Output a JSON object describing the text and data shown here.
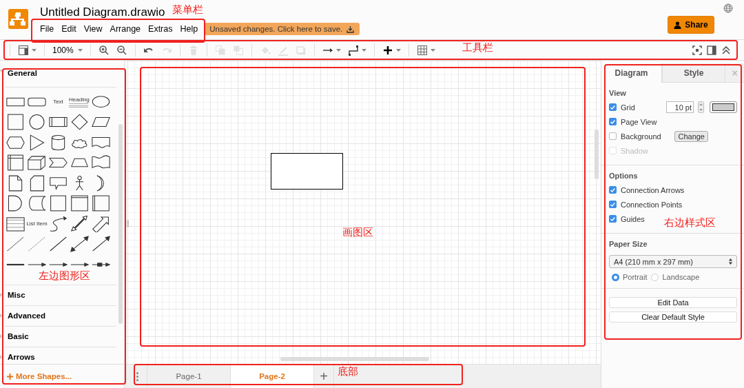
{
  "header": {
    "title": "Untitled Diagram.drawio",
    "menu": [
      "File",
      "Edit",
      "View",
      "Arrange",
      "Extras",
      "Help"
    ],
    "save_notice": "Unsaved changes. Click here to save.",
    "share": "Share"
  },
  "toolbar": {
    "groups": [
      [
        {
          "kind": "format",
          "disabled": false
        }
      ],
      [
        {
          "kind": "zoom",
          "text": "100%",
          "disabled": false
        }
      ],
      [
        {
          "kind": "zoom-in",
          "disabled": false
        },
        {
          "kind": "zoom-out",
          "disabled": false
        }
      ],
      [
        {
          "kind": "undo",
          "disabled": false
        },
        {
          "kind": "redo",
          "disabled": true
        }
      ],
      [
        {
          "kind": "delete",
          "disabled": true
        }
      ],
      [
        {
          "kind": "to-front",
          "disabled": true
        },
        {
          "kind": "to-back",
          "disabled": true
        }
      ],
      [
        {
          "kind": "fill",
          "disabled": true
        },
        {
          "kind": "line",
          "disabled": true
        },
        {
          "kind": "shadow",
          "disabled": true
        }
      ],
      [
        {
          "kind": "connection",
          "disabled": false
        },
        {
          "kind": "waypoints",
          "disabled": false
        }
      ],
      [
        {
          "kind": "insert",
          "disabled": false
        }
      ],
      [
        {
          "kind": "table",
          "disabled": false
        }
      ]
    ],
    "right": [
      {
        "kind": "fullscreen",
        "disabled": false
      },
      {
        "kind": "panel",
        "disabled": false
      },
      {
        "kind": "collapse",
        "disabled": false
      }
    ]
  },
  "sidebar": {
    "sections": [
      {
        "title": "General",
        "expanded": true,
        "shapes": [
          {
            "kind": "rect"
          },
          {
            "kind": "rounded"
          },
          {
            "kind": "text",
            "text": "Text"
          },
          {
            "kind": "heading",
            "text": "Heading"
          },
          {
            "kind": "ellipse"
          },
          {
            "kind": "square"
          },
          {
            "kind": "circle"
          },
          {
            "kind": "process"
          },
          {
            "kind": "diamond"
          },
          {
            "kind": "parallelogram"
          },
          {
            "kind": "hexagon"
          },
          {
            "kind": "triangle"
          },
          {
            "kind": "cylinder"
          },
          {
            "kind": "cloud"
          },
          {
            "kind": "document"
          },
          {
            "kind": "storage"
          },
          {
            "kind": "cube"
          },
          {
            "kind": "step"
          },
          {
            "kind": "trapezoid"
          },
          {
            "kind": "tape"
          },
          {
            "kind": "note"
          },
          {
            "kind": "card"
          },
          {
            "kind": "callout"
          },
          {
            "kind": "actor"
          },
          {
            "kind": "crescent"
          },
          {
            "kind": "delay"
          },
          {
            "kind": "stored"
          },
          {
            "kind": "square"
          },
          {
            "kind": "container"
          },
          {
            "kind": "vcontainer"
          },
          {
            "kind": "list"
          },
          {
            "kind": "listitem",
            "text": "List Item"
          },
          {
            "kind": "curve"
          },
          {
            "kind": "biarrow"
          },
          {
            "kind": "arrow"
          },
          {
            "kind": "dashed"
          },
          {
            "kind": "dotted"
          },
          {
            "kind": "line"
          },
          {
            "kind": "bidirectional"
          },
          {
            "kind": "directional"
          },
          {
            "kind": "thick"
          },
          {
            "kind": "connector"
          },
          {
            "kind": "connector"
          },
          {
            "kind": "connector"
          },
          {
            "kind": "boxconnector"
          }
        ]
      },
      {
        "title": "Misc",
        "expanded": false
      },
      {
        "title": "Advanced",
        "expanded": false
      },
      {
        "title": "Basic",
        "expanded": false
      },
      {
        "title": "Arrows",
        "expanded": false
      }
    ],
    "more": "More Shapes..."
  },
  "format_panel": {
    "tabs": [
      {
        "label": "Diagram",
        "selected": true
      },
      {
        "label": "Style",
        "selected": false
      }
    ],
    "close": "×",
    "sections": [
      {
        "title": "View",
        "items": [
          {
            "kind": "grid",
            "label": "Grid",
            "checked": true,
            "disabled": false,
            "value": "10 pt"
          },
          {
            "kind": "check",
            "label": "Page View",
            "checked": true,
            "disabled": false
          },
          {
            "kind": "background",
            "label": "Background",
            "checked": false,
            "disabled": false,
            "button": "Change"
          },
          {
            "kind": "check",
            "label": "Shadow",
            "checked": false,
            "disabled": true
          }
        ]
      },
      {
        "title": "Options",
        "items": [
          {
            "kind": "check",
            "label": "Connection Arrows",
            "checked": true,
            "disabled": false
          },
          {
            "kind": "check",
            "label": "Connection Points",
            "checked": true,
            "disabled": false
          },
          {
            "kind": "check",
            "label": "Guides",
            "checked": true,
            "disabled": false
          }
        ]
      },
      {
        "title": "Paper Size",
        "paper": "A4 (210 mm x 297 mm)",
        "orientations": [
          {
            "label": "Portrait",
            "selected": true
          },
          {
            "label": "Landscape",
            "selected": false
          }
        ]
      }
    ],
    "buttons": [
      "Edit Data",
      "Clear Default Style"
    ]
  },
  "pages": [
    {
      "label": "Page-1",
      "selected": false
    },
    {
      "label": "Page-2",
      "selected": true
    }
  ],
  "add_page": "+",
  "annotations": [
    {
      "kind": "menu",
      "label": "菜单栏"
    },
    {
      "kind": "toolbar",
      "label": "工具栏"
    },
    {
      "kind": "shapes",
      "label": "左边图形区"
    },
    {
      "kind": "canvas",
      "label": "画图区"
    },
    {
      "kind": "format",
      "label": "右边样式区"
    },
    {
      "kind": "bottom",
      "label": "底部"
    }
  ]
}
